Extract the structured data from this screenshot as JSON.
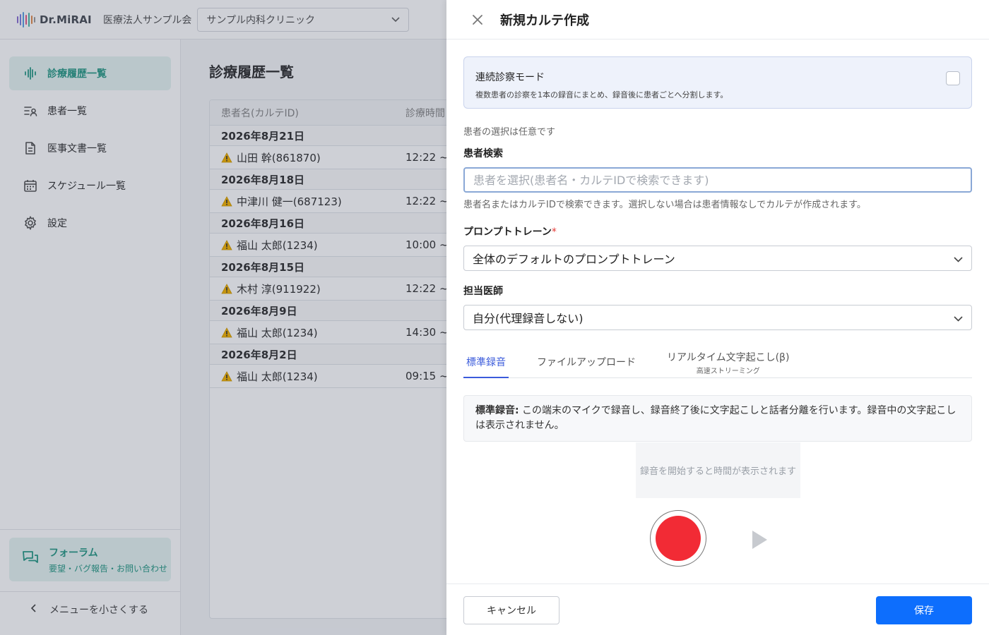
{
  "app": {
    "logo_text": "Dr.MiRAI",
    "org_name": "医療法人サンプル会",
    "clinic_select": "サンプル内科クリニック"
  },
  "sidebar": {
    "items": [
      {
        "label": "診療履歴一覧",
        "icon": "waveform-icon",
        "active": true
      },
      {
        "label": "患者一覧",
        "icon": "patient-list-icon",
        "active": false
      },
      {
        "label": "医事文書一覧",
        "icon": "document-icon",
        "active": false
      },
      {
        "label": "スケジュール一覧",
        "icon": "calendar-icon",
        "active": false
      },
      {
        "label": "設定",
        "icon": "gear-icon",
        "active": false
      }
    ],
    "forum_title": "フォーラム",
    "forum_sub": "要望・バグ報告・お問い合わせ",
    "collapse_label": "メニューを小さくする"
  },
  "main": {
    "title": "診療履歴一覧",
    "columns": [
      "患者名(カルテID)",
      "診療時間"
    ],
    "groups": [
      {
        "date": "2026年8月21日",
        "records": [
          {
            "name": "山田 幹(861870)",
            "time": "12:22 ~"
          }
        ]
      },
      {
        "date": "2026年8月18日",
        "records": [
          {
            "name": "中津川 健一(687123)",
            "time": "12:22 ~"
          }
        ]
      },
      {
        "date": "2026年8月16日",
        "records": [
          {
            "name": "福山 太郎(1234)",
            "time": "10:00 ~"
          }
        ]
      },
      {
        "date": "2026年8月15日",
        "records": [
          {
            "name": "木村 淳(911922)",
            "time": "12:22 ~"
          }
        ]
      },
      {
        "date": "2026年8月9日",
        "records": [
          {
            "name": "福山 太郎(1234)",
            "time": "14:30 ~"
          }
        ]
      },
      {
        "date": "2026年8月2日",
        "records": [
          {
            "name": "福山 太郎(1234)",
            "time": "09:15 ~"
          }
        ]
      }
    ]
  },
  "drawer": {
    "title": "新規カルテ作成",
    "consecutive_mode": {
      "title": "連続診察モード",
      "description": "複数患者の診察を1本の録音にまとめ、録音後に患者ごとへ分割します。",
      "checked": false
    },
    "optional_note": "患者の選択は任意です",
    "patient_search": {
      "label": "患者検索",
      "value": "",
      "placeholder": "患者を選択(患者名・カルテIDで検索できます)",
      "help": "患者名またはカルテIDで検索できます。選択しない場合は患者情報なしでカルテが作成されます。"
    },
    "prompt_train": {
      "label": "プロンプトトレーン",
      "required_mark": "*",
      "value": "全体のデフォルトのプロンプトトレーン"
    },
    "doctor": {
      "label": "担当医師",
      "value": "自分(代理録音しない)"
    },
    "tabs": [
      {
        "label": "標準録音",
        "sub": "",
        "active": true
      },
      {
        "label": "ファイルアップロード",
        "sub": "",
        "active": false
      },
      {
        "label": "リアルタイム文字起こし(β)",
        "sub": "高速ストリーミング",
        "active": false
      }
    ],
    "info": {
      "bold": "標準録音:",
      "text": " この端末のマイクで録音し、録音終了後に文字起こしと話者分離を行います。録音中の文字起こしは表示されません。"
    },
    "timer_placeholder": "録音を開始すると時間が表示されます",
    "cancel_label": "キャンセル",
    "save_label": "保存"
  },
  "colors": {
    "accent": "#2a9a86",
    "primary": "#0d6efd",
    "record": "#f22b35",
    "tab_active": "#3b5bdb"
  }
}
